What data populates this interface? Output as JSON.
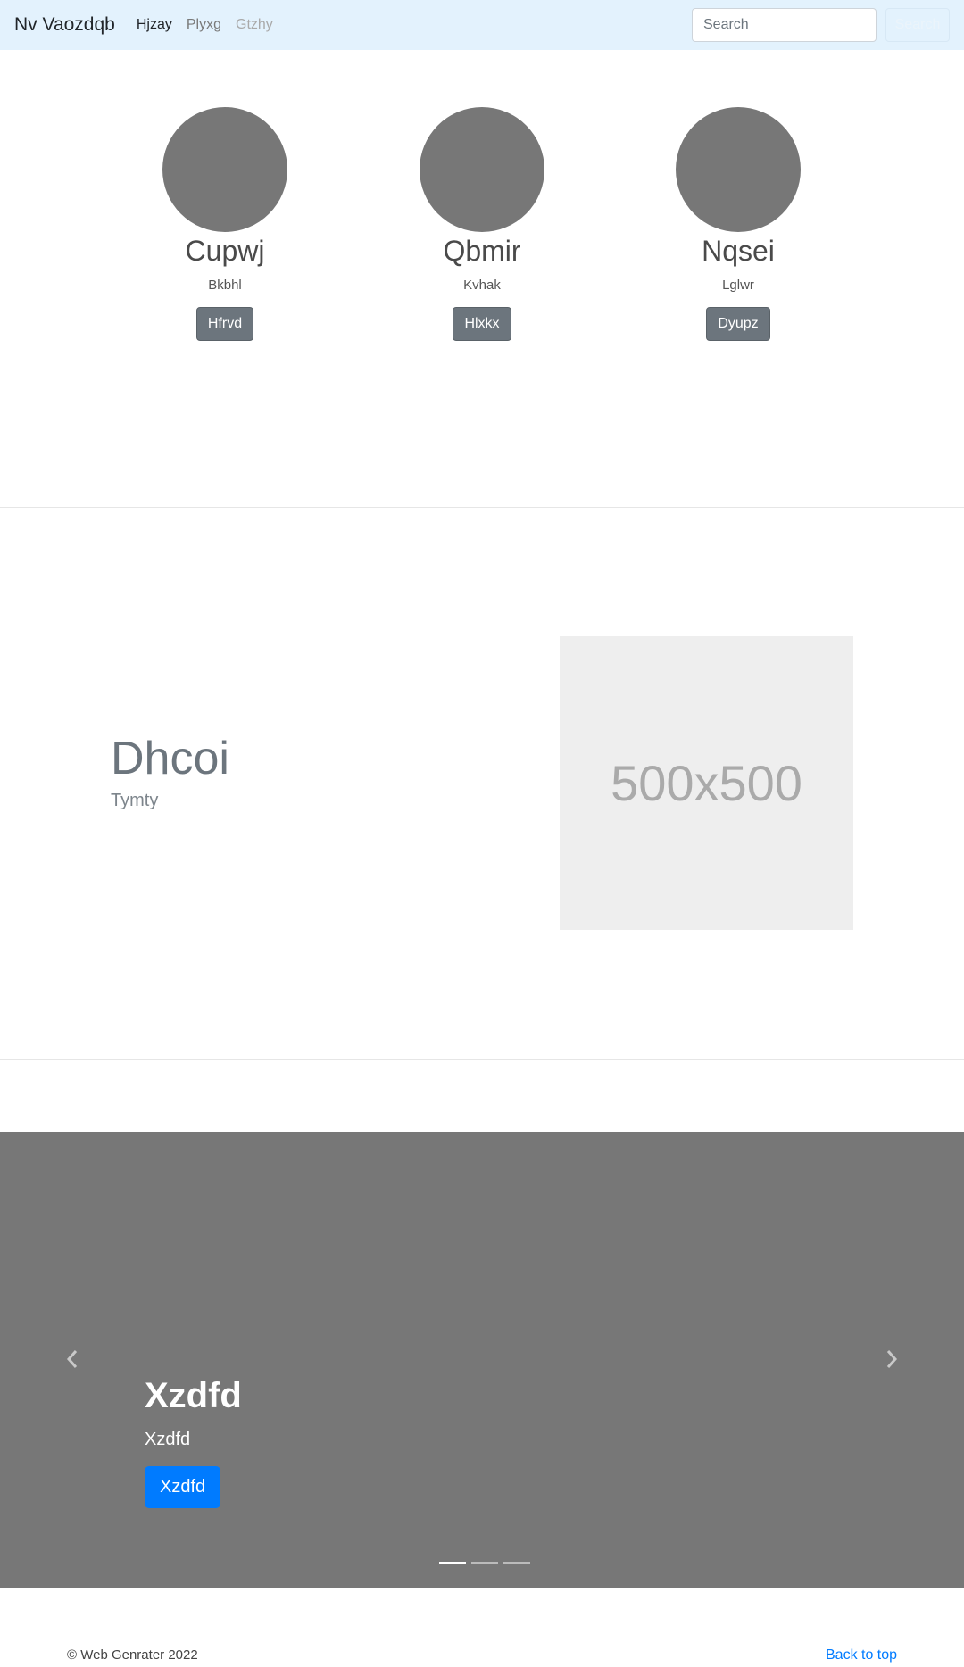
{
  "navbar": {
    "brand": "Nv Vaozdqb",
    "links": [
      {
        "label": "Hjzay",
        "state": "active"
      },
      {
        "label": "Plyxg",
        "state": "normal"
      },
      {
        "label": "Gtzhy",
        "state": "disabled"
      }
    ],
    "search_placeholder": "Search",
    "search_button": "Search"
  },
  "profiles": [
    {
      "name": "Cupwj",
      "role": "Bkbhl",
      "button": "Hfrvd"
    },
    {
      "name": "Qbmir",
      "role": "Kvhak",
      "button": "Hlxkx"
    },
    {
      "name": "Nqsei",
      "role": "Lglwr",
      "button": "Dyupz"
    }
  ],
  "feature": {
    "heading": "Dhcoi",
    "subheading": "Tymty",
    "image_label": "500x500"
  },
  "carousel": {
    "title": "Xzdfd",
    "text": "Xzdfd",
    "button": "Xzdfd",
    "active_indicator": 0,
    "indicator_count": 3
  },
  "footer": {
    "copyright": "© Web Genrater 2022",
    "back_to_top": "Back to top"
  },
  "colors": {
    "navbar_bg": "#e3f2fd",
    "avatar": "#777777",
    "profile_button": "#6c757d",
    "carousel_bg": "#777777",
    "primary": "#007bff"
  }
}
